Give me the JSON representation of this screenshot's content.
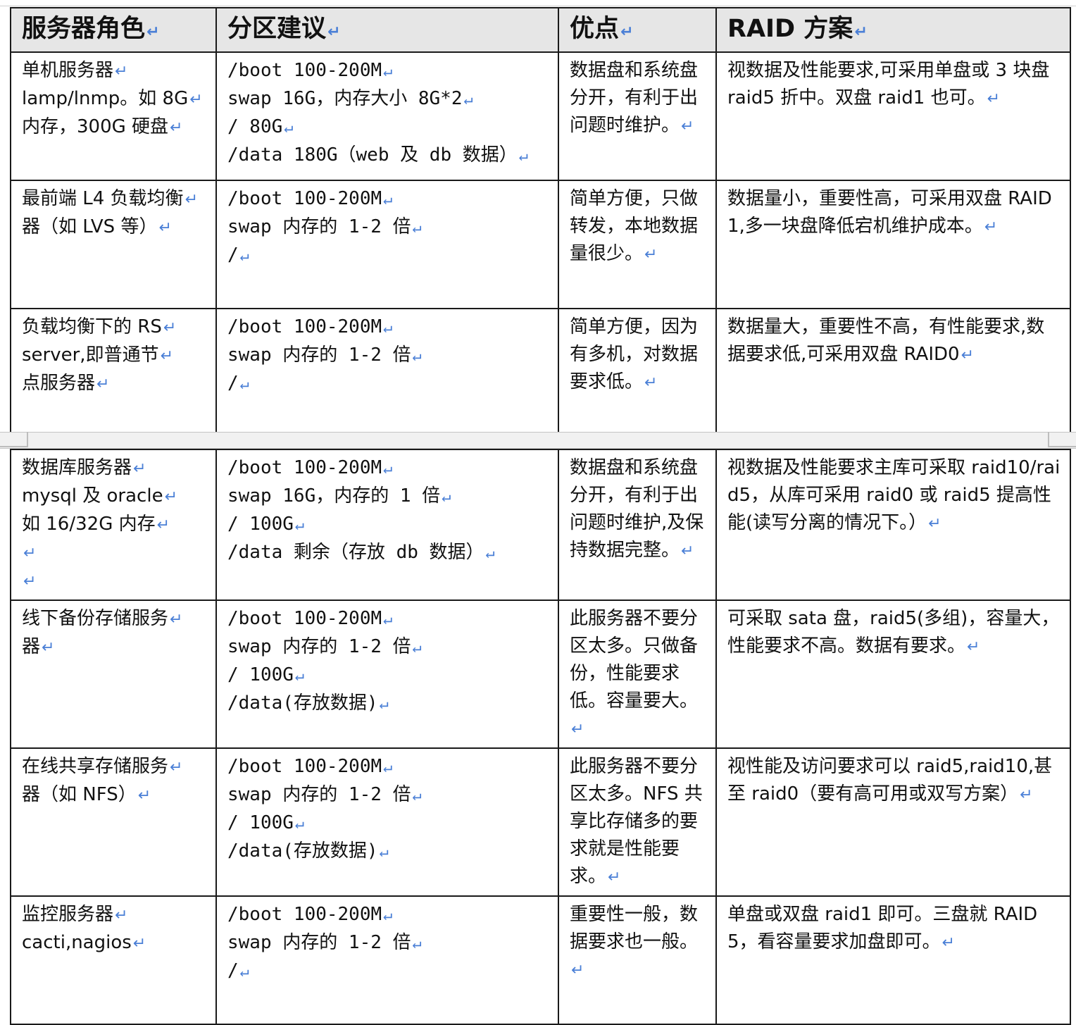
{
  "headers": [
    "服务器角色",
    "分区建议",
    "优点",
    "RAID 方案"
  ],
  "part1": [
    {
      "role": [
        "单机服务器",
        "lamp/lnmp。如 8G",
        "内存，300G 硬盘"
      ],
      "partition": [
        "/boot  100-200M",
        "swap  16G，内存大小 8G*2",
        "/  80G",
        "/data  180G（web 及 db 数据）"
      ],
      "advantage": "数据盘和系统盘分开，有利于出问题时维护。",
      "raid": "视数据及性能要求,可采用单盘或 3 块盘 raid5 折中。双盘 raid1 也可。"
    },
    {
      "role": [
        "最前端 L4 负载均衡",
        "器（如 LVS 等）"
      ],
      "partition": [
        "/boot  100-200M",
        "swap  内存的 1-2 倍",
        "/"
      ],
      "advantage": "简单方便，只做转发，本地数据量很少。",
      "raid": "数据量小，重要性高，可采用双盘 RAID1,多一块盘降低宕机维护成本。"
    },
    {
      "role": [
        "负载均衡下的 RS",
        "server,即普通节",
        "点服务器"
      ],
      "partition": [
        "/boot  100-200M",
        "swap  内存的 1-2 倍",
        "/"
      ],
      "advantage": "简单方便，因为有多机，对数据要求低。",
      "raid": "数据量大，重要性不高，有性能要求,数据要求低,可采用双盘 RAID0"
    }
  ],
  "part2": [
    {
      "role": [
        "数据库服务器",
        "mysql 及 oracle",
        "如 16/32G 内存",
        "",
        ""
      ],
      "partition": [
        "/boot  100-200M",
        "swap  16G，内存的 1 倍",
        "/  100G",
        "/data  剩余（存放 db 数据）"
      ],
      "advantage": "数据盘和系统盘分开，有利于出问题时维护,及保持数据完整。",
      "raid": "视数据及性能要求主库可采取 raid10/raid5，从库可采用 raid0 或 raid5 提高性能(读写分离的情况下。）"
    },
    {
      "role": [
        "线下备份存储服务",
        "器"
      ],
      "partition": [
        "/boot  100-200M",
        "swap  内存的 1-2 倍",
        "/  100G",
        "/data(存放数据)"
      ],
      "advantage": "此服务器不要分区太多。只做备份，性能要求低。容量要大。",
      "raid": "可采取 sata 盘，raid5(多组)，容量大，性能要求不高。数据有要求。"
    },
    {
      "role": [
        "在线共享存储服务",
        "器（如 NFS）"
      ],
      "partition": [
        "/boot  100-200M",
        "swap  内存的 1-2 倍",
        "/  100G",
        "/data(存放数据)"
      ],
      "advantage": "此服务器不要分区太多。NFS 共享比存储多的要求就是性能要求。",
      "raid": "视性能及访问要求可以 raid5,raid10,甚至 raid0（要有高可用或双写方案）"
    },
    {
      "role": [
        "监控服务器",
        "cacti,nagios"
      ],
      "partition": [
        "/boot  100-200M",
        "swap  内存的 1-2 倍",
        "/"
      ],
      "advantage": "重要性一般，数据要求也一般。",
      "raid": "单盘或双盘 raid1 即可。三盘就 RAID5，看容量要求加盘即可。"
    }
  ]
}
